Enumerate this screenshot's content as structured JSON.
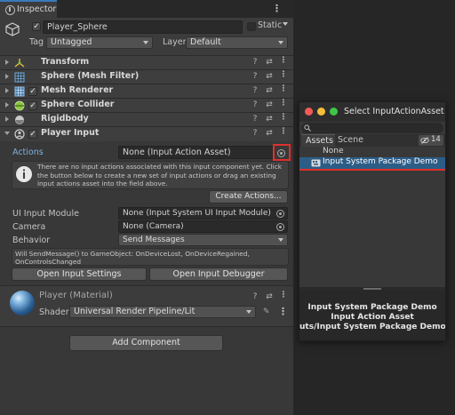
{
  "inspector": {
    "tab_label": "Inspector",
    "object": {
      "name": "Player_Sphere",
      "static_label": "Static",
      "tag_label": "Tag",
      "tag_value": "Untagged",
      "layer_label": "Layer",
      "layer_value": "Default"
    },
    "components": [
      {
        "name": "Transform",
        "icon": "transform-icon"
      },
      {
        "name": "Sphere (Mesh Filter)",
        "icon": "mesh-filter-icon"
      },
      {
        "name": "Mesh Renderer",
        "icon": "mesh-renderer-icon"
      },
      {
        "name": "Sphere Collider",
        "icon": "sphere-collider-icon"
      },
      {
        "name": "Rigidbody",
        "icon": "rigidbody-icon"
      },
      {
        "name": "Player Input",
        "icon": "player-input-icon"
      }
    ],
    "player_input": {
      "actions_label": "Actions",
      "actions_value": "None (Input Action Asset)",
      "help_text": "There are no input actions associated with this input component yet. Click the button below to create a new set of input actions or drag an existing input actions asset into the field above.",
      "create_actions_label": "Create Actions...",
      "ui_input_module_label": "UI Input Module",
      "ui_input_module_value": "None (Input System UI Input Module)",
      "camera_label": "Camera",
      "camera_value": "None (Camera)",
      "behavior_label": "Behavior",
      "behavior_value": "Send Messages",
      "send_message_info": "Will SendMessage() to GameObject: OnDeviceLost, OnDeviceRegained, OnControlsChanged",
      "open_settings_label": "Open Input Settings",
      "open_debugger_label": "Open Input Debugger"
    },
    "material": {
      "name": "Player (Material)",
      "shader_label": "Shader",
      "shader_value": "Universal Render Pipeline/Lit"
    },
    "add_component_label": "Add Component"
  },
  "popup": {
    "title": "Select InputActionAsset",
    "tabs": [
      "Assets",
      "Scene"
    ],
    "count": "14",
    "items": [
      "None",
      "Input System Package Demo"
    ],
    "preview_lines": [
      "Input System Package Demo",
      "Input Action Asset",
      "uts/Input System Package Demo.in"
    ]
  },
  "colors": {
    "accent": "#3a79bb",
    "selection": "#2c5d87",
    "highlight_box": "#e0302c"
  }
}
